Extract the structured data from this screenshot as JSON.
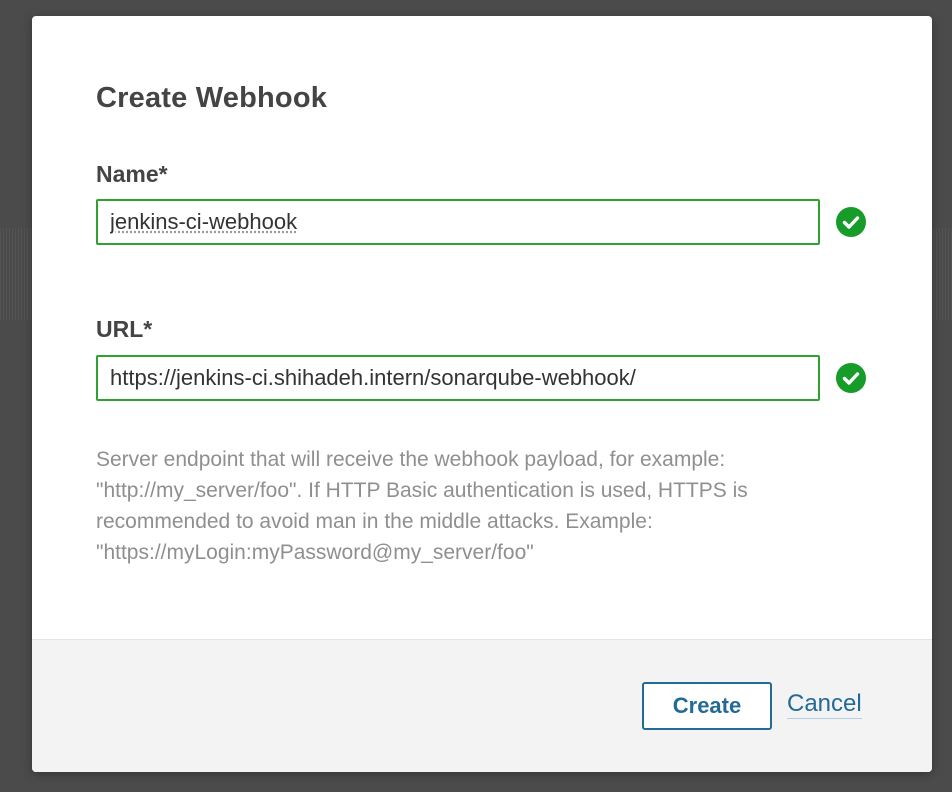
{
  "modal": {
    "title": "Create Webhook",
    "fields": {
      "name": {
        "label": "Name*",
        "value": "jenkins-ci-webhook",
        "status_icon": "check-circle-icon"
      },
      "url": {
        "label": "URL*",
        "value": "https://jenkins-ci.shihadeh.intern/sonarqube-webhook/",
        "status_icon": "check-circle-icon",
        "help_text": "Server endpoint that will receive the webhook payload, for example: \"http://my_server/foo\". If HTTP Basic authentication is used, HTTPS is recommended to avoid man in the middle attacks. Example: \"https://myLogin:myPassword@my_server/foo\""
      }
    },
    "footer": {
      "create_label": "Create",
      "cancel_label": "Cancel"
    }
  },
  "colors": {
    "valid_green": "#179c2a",
    "input_border_green": "#2ea12e",
    "primary_blue": "#236a97",
    "footer_bg": "#f3f3f3",
    "overlay_bg": "#4b4b4b"
  }
}
